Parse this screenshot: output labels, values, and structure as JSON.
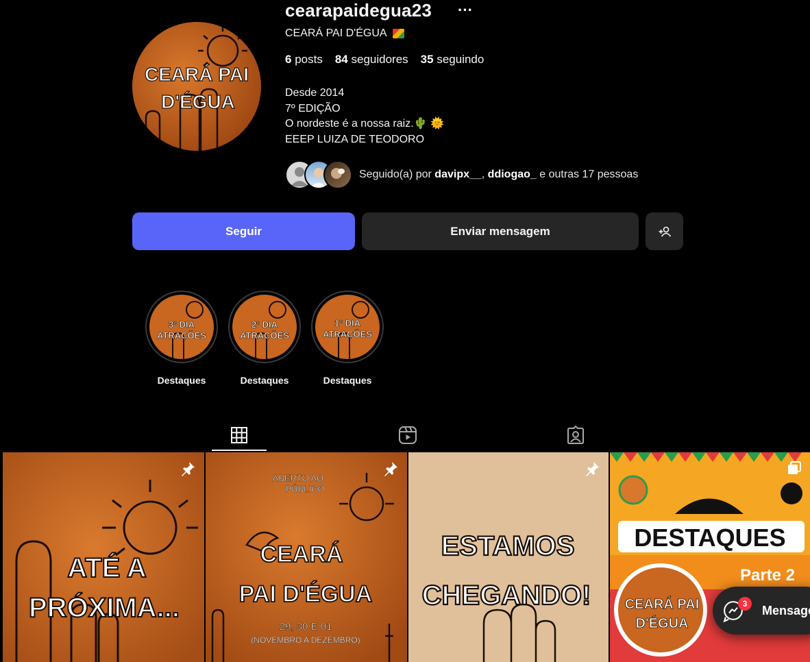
{
  "profile": {
    "username": "cearapaidegua23",
    "full_name": "CEARÁ PAI D'ÉGUA",
    "stats": {
      "posts_count": "6",
      "posts_label": "posts",
      "followers_count": "84",
      "followers_label": "seguidores",
      "following_count": "35",
      "following_label": "seguindo"
    },
    "bio": [
      "Desde 2014",
      "7º EDIÇÃO",
      "O nordeste é a nossa raiz.🌵 🌞",
      "EEEP LUIZA DE TEODORO"
    ],
    "followed_by": {
      "prefix": "Seguido(a) por",
      "user1": "davipx__",
      "user2": "ddiogao_",
      "suffix": "e outras 17 pessoas"
    },
    "avatar_text": [
      "CEARÁ PAI",
      "D'ÉGUA"
    ]
  },
  "actions": {
    "follow": "Seguir",
    "message": "Enviar mensagem"
  },
  "highlights": [
    {
      "label": "Destaques",
      "line1": "3º DIA",
      "line2": "ATRAÇÕES"
    },
    {
      "label": "Destaques",
      "line1": "2º DIA",
      "line2": "ATRAÇÕES"
    },
    {
      "label": "Destaques",
      "line1": "1º DIA",
      "line2": "ATRAÇÕES"
    }
  ],
  "posts": [
    {
      "lines": [
        "ATÉ A",
        "PRÓXIMA..."
      ]
    },
    {
      "top": [
        "ABERTO AO",
        "PÚBLICO"
      ],
      "lines": [
        "CEARÁ",
        "PAI D'ÉGUA"
      ],
      "date": "29, 30 E 01",
      "date_sub": "(NOVEMBRO A DEZEMBRO)"
    },
    {
      "lines": [
        "ESTAMOS",
        "CHEGANDO!"
      ]
    },
    {
      "title": "DESTAQUES",
      "subtitle": "Parte 2",
      "logo": [
        "CEARÁ PAI",
        "D'ÉGUA"
      ]
    }
  ],
  "messages": {
    "label": "Mensagens",
    "badge": "3"
  },
  "colors": {
    "accent": "#5865f8",
    "button_dark": "#262626",
    "orange": "#c8641e",
    "badge": "#ff3040"
  }
}
